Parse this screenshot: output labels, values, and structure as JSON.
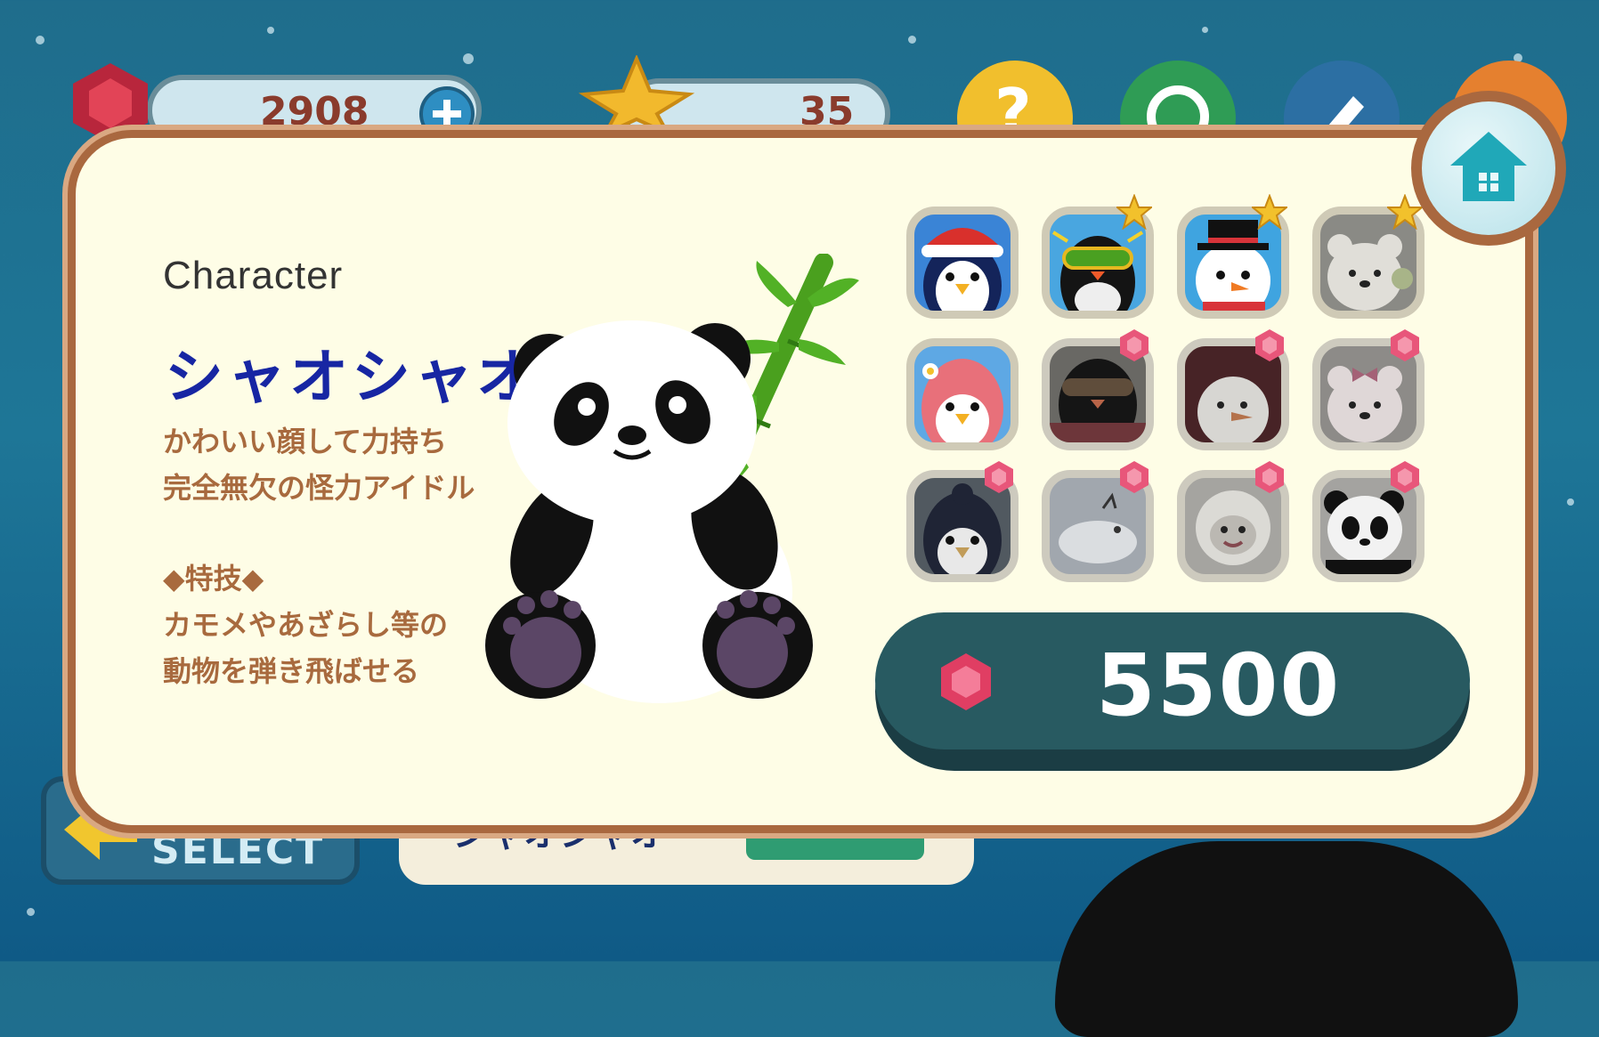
{
  "hud": {
    "gems": "2908",
    "stars": "35"
  },
  "background": {
    "select_label": "SELECT",
    "current_name": "シャオシャオ"
  },
  "character_panel": {
    "section_label": "Character",
    "name": "シャオシャオ",
    "description_lines": [
      "かわいい顔して力持ち",
      "完全無欠の怪力アイドル"
    ],
    "skill_header": "◆特技◆",
    "skill_lines": [
      "カモメやあざらし等の",
      "動物を弾き飛ばせる"
    ]
  },
  "character_grid": [
    {
      "name": "santa-penguin",
      "badge": "none"
    },
    {
      "name": "rockhopper-penguin",
      "badge": "star"
    },
    {
      "name": "snowman",
      "badge": "star"
    },
    {
      "name": "polar-bear",
      "badge": "star"
    },
    {
      "name": "flower-penguin",
      "badge": "none"
    },
    {
      "name": "aloha-penguin",
      "badge": "gem"
    },
    {
      "name": "red-snowman",
      "badge": "gem"
    },
    {
      "name": "ribbon-bear",
      "badge": "gem"
    },
    {
      "name": "kimono-penguin",
      "badge": "gem"
    },
    {
      "name": "seal",
      "badge": "gem"
    },
    {
      "name": "sheep",
      "badge": "gem"
    },
    {
      "name": "panda",
      "badge": "gem"
    }
  ],
  "buy_button": {
    "price": "5500"
  },
  "colors": {
    "panel_bg": "#fefde6",
    "name_blue": "#1726a3",
    "desc_brown": "#a86a3e",
    "buy_green": "#285a61",
    "gem_pink": "#e8567a"
  }
}
